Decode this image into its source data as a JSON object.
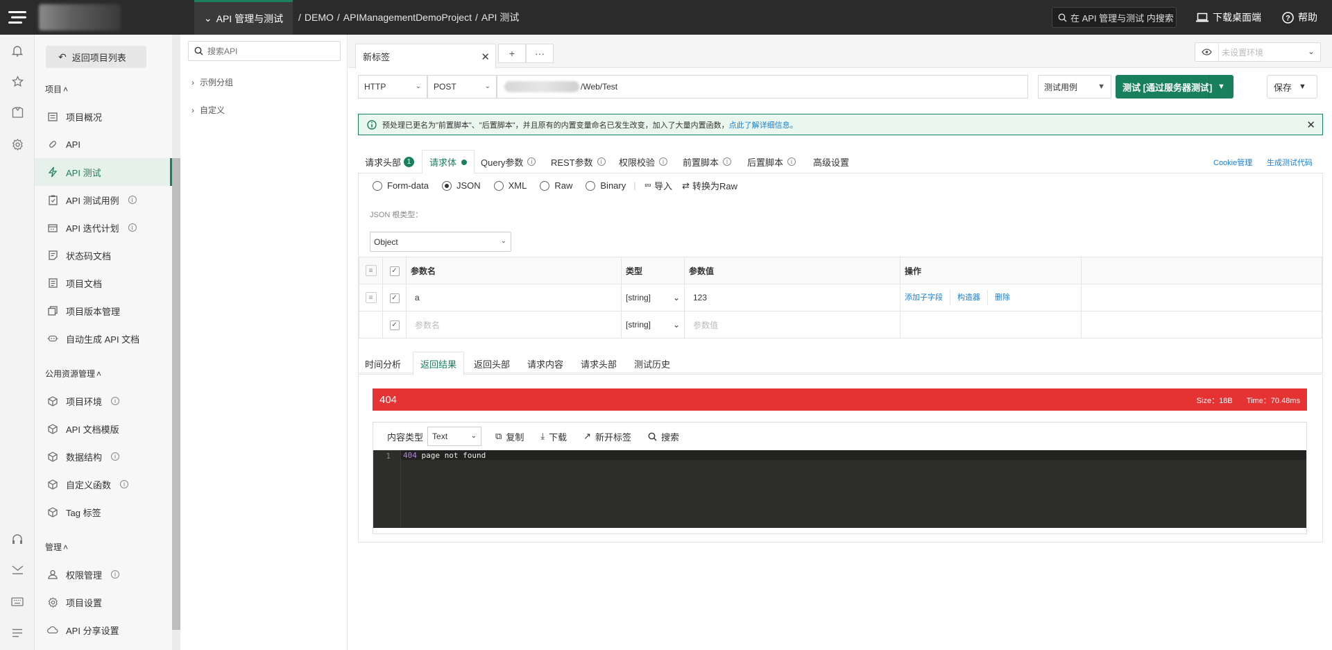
{
  "header": {
    "module": "API 管理与测试",
    "breadcrumb": [
      "DEMO",
      "APIManagementDemoProject",
      "API 测试"
    ],
    "search_placeholder": "在 API 管理与测试 内搜索",
    "download": "下载桌面端",
    "help": "帮助"
  },
  "nav": {
    "back": "返回项目列表",
    "group_project": "项目",
    "group_public": "公用资源管理",
    "group_admin": "管理",
    "items": [
      {
        "label": "项目概况",
        "icon": "overview-icon"
      },
      {
        "label": "API",
        "icon": "api-icon"
      },
      {
        "label": "API 测试",
        "icon": "lightning-icon",
        "active": true
      },
      {
        "label": "API 测试用例",
        "icon": "testcase-icon",
        "info": true
      },
      {
        "label": "API 迭代计划",
        "icon": "calendar-icon",
        "info": true
      },
      {
        "label": "状态码文档",
        "icon": "statuscode-icon"
      },
      {
        "label": "项目文档",
        "icon": "document-icon"
      },
      {
        "label": "项目版本管理",
        "icon": "version-icon"
      },
      {
        "label": "自动生成 API 文档",
        "icon": "robot-icon"
      }
    ],
    "public_items": [
      {
        "label": "项目环境",
        "info": true
      },
      {
        "label": "API 文档模版"
      },
      {
        "label": "数据结构",
        "info": true
      },
      {
        "label": "自定义函数",
        "info": true
      },
      {
        "label": "Tag 标签"
      }
    ],
    "admin_items": [
      {
        "label": "权限管理",
        "info": true
      },
      {
        "label": "项目设置"
      },
      {
        "label": "API 分享设置"
      }
    ]
  },
  "tree": {
    "search_placeholder": "搜索API",
    "nodes": [
      "示例分组",
      "自定义"
    ]
  },
  "tabs": {
    "current": "新标签",
    "add": "+",
    "more": "···",
    "env_placeholder": "未设置环境"
  },
  "request": {
    "protocol": "HTTP",
    "method": "POST",
    "url_suffix": "/Web/Test",
    "testcase": "测试用例",
    "test_button": "测试 [通过服务器测试]",
    "save": "保存"
  },
  "notice": {
    "text": "预处理已更名为\"前置脚本\"、\"后置脚本\"，并且原有的内置变量命名已发生改变，加入了大量内置函数，",
    "link": "点此了解详细信息。"
  },
  "req_tabs": {
    "headers": "请求头部",
    "headers_count": "1",
    "body": "请求体",
    "query": "Query参数",
    "rest": "REST参数",
    "auth": "权限校验",
    "pre_script": "前置脚本",
    "post_script": "后置脚本",
    "advanced": "高级设置",
    "cookie": "Cookie管理",
    "gen_code": "生成测试代码"
  },
  "body_types": [
    "Form-data",
    "JSON",
    "XML",
    "Raw",
    "Binary"
  ],
  "body_selected": "JSON",
  "body_actions": {
    "import": "导入",
    "to_raw": "转换为Raw"
  },
  "json_root_label": "JSON 根类型：",
  "json_root": "Object",
  "param_table": {
    "headers": {
      "name": "参数名",
      "type": "类型",
      "value": "参数值",
      "op": "操作"
    },
    "rows": [
      {
        "name": "a",
        "type": "[string]",
        "value": "123"
      }
    ],
    "ops": [
      "添加子字段",
      "构造器",
      "删除"
    ],
    "empty_row": {
      "name_ph": "参数名",
      "type": "[string]",
      "value_ph": "参数值"
    }
  },
  "res_tabs": [
    "时间分析",
    "返回结果",
    "返回头部",
    "请求内容",
    "请求头部",
    "测试历史"
  ],
  "res_active": "返回结果",
  "response": {
    "status": "404",
    "size": "Size：18B",
    "time": "Time：70.48ms",
    "content_type_label": "内容类型",
    "content_type": "Text",
    "copy": "复制",
    "download": "下载",
    "new_tab": "新开标签",
    "search": "搜索",
    "line_no": "1",
    "line_num": "404",
    "line_text": " page not found",
    "status_color": "#e53333"
  },
  "colors": {
    "accent": "#19805d",
    "link": "#1a7fd1",
    "topbar": "#2b2b2b"
  }
}
